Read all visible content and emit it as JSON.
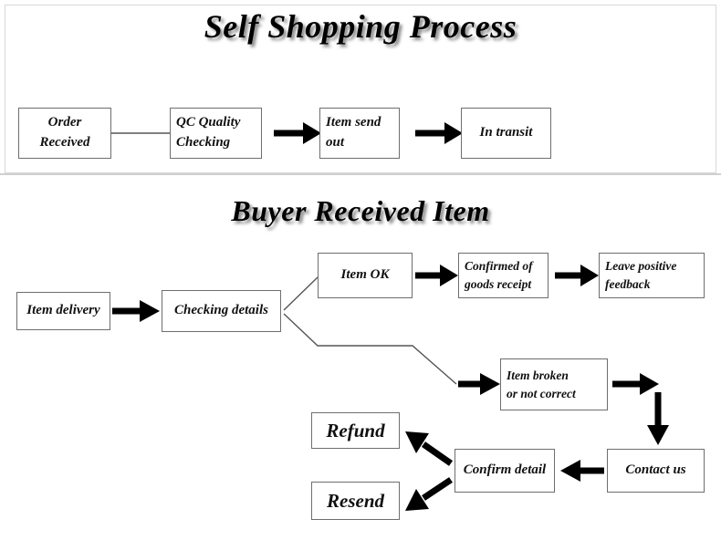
{
  "sections": [
    {
      "id": "self-shopping-process",
      "title": "Self Shopping Process",
      "nodes": [
        {
          "id": "order-received",
          "lines": [
            "Order",
            "Received"
          ],
          "align": "center"
        },
        {
          "id": "qc-quality-checking",
          "lines": [
            "QC Quality",
            "Checking"
          ],
          "align": "left"
        },
        {
          "id": "item-send-out",
          "lines": [
            "Item send",
            "out"
          ],
          "align": "left"
        },
        {
          "id": "in-transit",
          "lines": [
            "In transit"
          ],
          "align": "center"
        }
      ]
    },
    {
      "id": "buyer-received-item",
      "title": "Buyer Received Item",
      "nodes": [
        {
          "id": "item-delivery",
          "lines": [
            "Item delivery"
          ],
          "align": "center"
        },
        {
          "id": "checking-details",
          "lines": [
            "Checking details"
          ],
          "align": "center"
        },
        {
          "id": "item-ok",
          "lines": [
            "Item OK"
          ],
          "align": "center"
        },
        {
          "id": "confirmed-goods-receipt",
          "lines": [
            "Confirmed of",
            "goods receipt"
          ],
          "align": "left"
        },
        {
          "id": "leave-positive-feedback",
          "lines": [
            "Leave positive",
            "feedback"
          ],
          "align": "left"
        },
        {
          "id": "item-broken",
          "lines": [
            "Item broken",
            "or not correct"
          ],
          "align": "left"
        },
        {
          "id": "contact-us",
          "lines": [
            "Contact us"
          ],
          "align": "center"
        },
        {
          "id": "confirm-detail",
          "lines": [
            "Confirm detail"
          ],
          "align": "center"
        },
        {
          "id": "refund",
          "lines": [
            "Refund"
          ],
          "align": "center"
        },
        {
          "id": "resend",
          "lines": [
            "Resend"
          ],
          "align": "center"
        }
      ]
    }
  ],
  "colors": {
    "box_border": "#6e6e6e",
    "arrow": "#000000",
    "thin_line": "#555555",
    "background": "#ffffff",
    "title_shadow": "#787878"
  }
}
